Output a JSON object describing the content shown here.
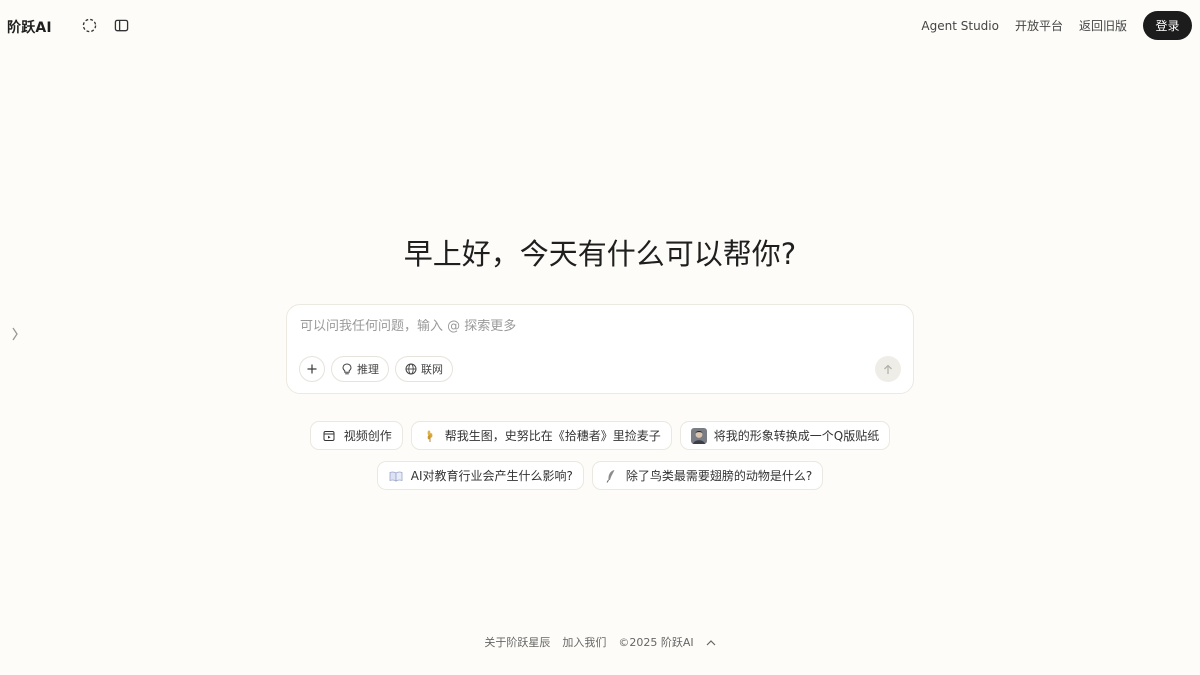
{
  "header": {
    "logo": "阶跃AI",
    "nav": {
      "agent_studio": "Agent Studio",
      "open_platform": "开放平台",
      "old_version": "返回旧版",
      "login": "登录"
    }
  },
  "main": {
    "greeting": "早上好，今天有什么可以帮你?",
    "input": {
      "placeholder": "可以问我任何问题，输入 @ 探索更多",
      "value": ""
    },
    "tools": {
      "plus": "+",
      "reasoning": "推理",
      "web": "联网"
    },
    "suggestions_row1": [
      {
        "label": "视频创作",
        "icon": "video-icon"
      },
      {
        "label": "帮我生图，史努比在《拾穗者》里捡麦子",
        "icon": "wheat-icon"
      },
      {
        "label": "将我的形象转换成一个Q版贴纸",
        "icon": "avatar-thumb"
      }
    ],
    "suggestions_row2": [
      {
        "label": "AI对教育行业会产生什么影响?",
        "icon": "book-icon"
      },
      {
        "label": "除了鸟类最需要翅膀的动物是什么?",
        "icon": "feather-icon"
      }
    ]
  },
  "footer": {
    "about": "关于阶跃星辰",
    "join": "加入我们",
    "copyright": "©2025 阶跃AI"
  },
  "colors": {
    "background": "#fdfcf8",
    "login_button": "#1c1c1c"
  }
}
